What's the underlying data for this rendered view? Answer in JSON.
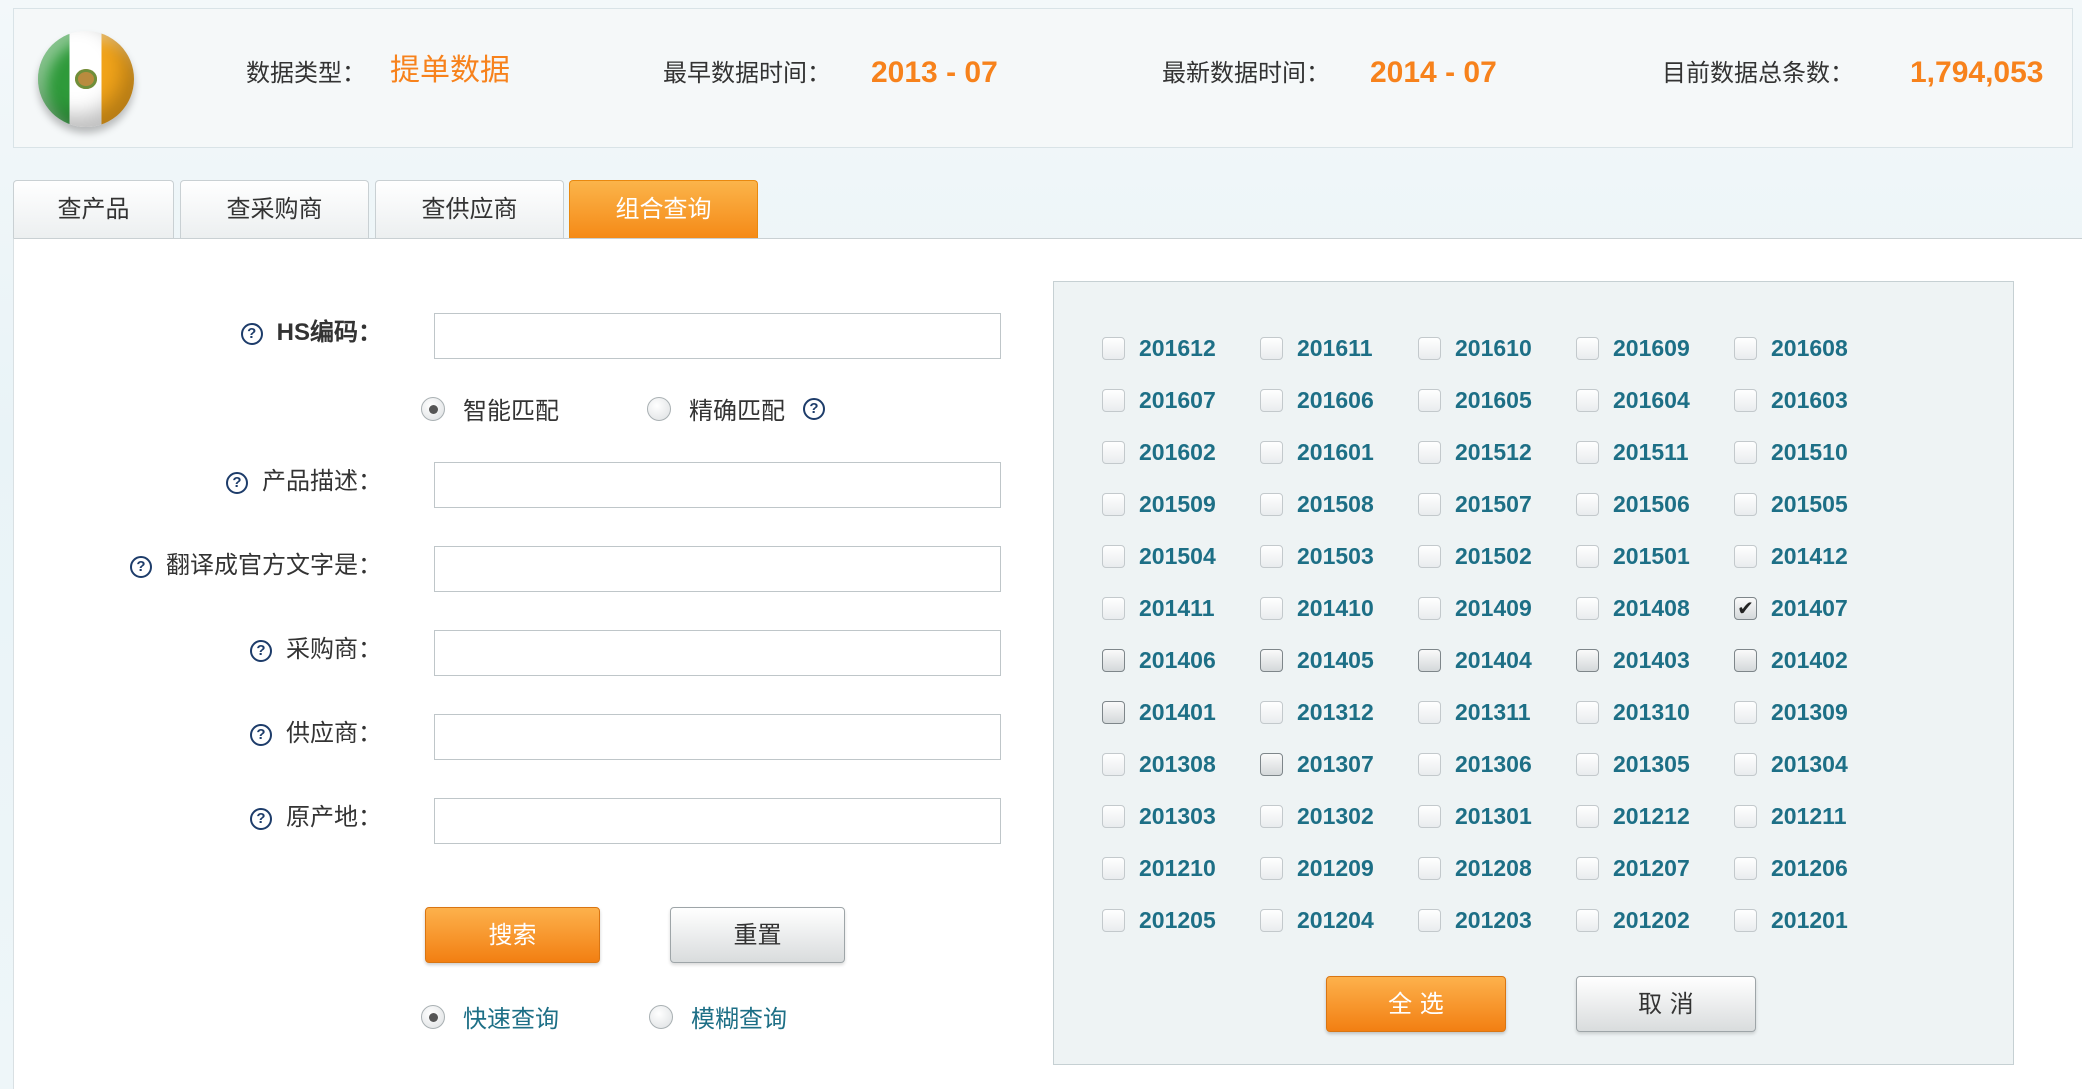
{
  "header": {
    "flag_icon": "mexico-flag-icon",
    "data_type_label": "数据类型：",
    "data_type_value": "提单数据",
    "earliest_label": "最早数据时间：",
    "earliest_value": "2013 - 07",
    "latest_label": "最新数据时间：",
    "latest_value": "2014 - 07",
    "total_label": "目前数据总条数：",
    "total_value": "1,794,053",
    "accent_color": "#f7821c"
  },
  "tabs": [
    {
      "label": "查产品",
      "active": false
    },
    {
      "label": "查采购商",
      "active": false
    },
    {
      "label": "查供应商",
      "active": false
    },
    {
      "label": "组合查询",
      "active": true
    }
  ],
  "form": {
    "help_icon": "?",
    "hs_label": "HS编码：",
    "hs_value": "",
    "match_options": [
      {
        "label": "智能匹配",
        "selected": true
      },
      {
        "label": "精确匹配",
        "selected": false
      }
    ],
    "product_label": "产品描述：",
    "product_value": "",
    "translate_label": "翻译成官方文字是：",
    "translate_value": "",
    "buyer_label": "采购商：",
    "buyer_value": "",
    "supplier_label": "供应商：",
    "supplier_value": "",
    "origin_label": "原产地：",
    "origin_value": "",
    "search_button": "搜索",
    "reset_button": "重置",
    "query_modes": [
      {
        "label": "快速查询",
        "selected": true
      },
      {
        "label": "模糊查询",
        "selected": false
      }
    ]
  },
  "months": {
    "items": [
      {
        "label": "201612",
        "checked": false,
        "style": "light"
      },
      {
        "label": "201611",
        "checked": false,
        "style": "light"
      },
      {
        "label": "201610",
        "checked": false,
        "style": "light"
      },
      {
        "label": "201609",
        "checked": false,
        "style": "light"
      },
      {
        "label": "201608",
        "checked": false,
        "style": "light"
      },
      {
        "label": "201607",
        "checked": false,
        "style": "light"
      },
      {
        "label": "201606",
        "checked": false,
        "style": "light"
      },
      {
        "label": "201605",
        "checked": false,
        "style": "light"
      },
      {
        "label": "201604",
        "checked": false,
        "style": "light"
      },
      {
        "label": "201603",
        "checked": false,
        "style": "light"
      },
      {
        "label": "201602",
        "checked": false,
        "style": "light"
      },
      {
        "label": "201601",
        "checked": false,
        "style": "light"
      },
      {
        "label": "201512",
        "checked": false,
        "style": "light"
      },
      {
        "label": "201511",
        "checked": false,
        "style": "light"
      },
      {
        "label": "201510",
        "checked": false,
        "style": "light"
      },
      {
        "label": "201509",
        "checked": false,
        "style": "light"
      },
      {
        "label": "201508",
        "checked": false,
        "style": "light"
      },
      {
        "label": "201507",
        "checked": false,
        "style": "light"
      },
      {
        "label": "201506",
        "checked": false,
        "style": "light"
      },
      {
        "label": "201505",
        "checked": false,
        "style": "light"
      },
      {
        "label": "201504",
        "checked": false,
        "style": "light"
      },
      {
        "label": "201503",
        "checked": false,
        "style": "light"
      },
      {
        "label": "201502",
        "checked": false,
        "style": "light"
      },
      {
        "label": "201501",
        "checked": false,
        "style": "light"
      },
      {
        "label": "201412",
        "checked": false,
        "style": "light"
      },
      {
        "label": "201411",
        "checked": false,
        "style": "light"
      },
      {
        "label": "201410",
        "checked": false,
        "style": "light"
      },
      {
        "label": "201409",
        "checked": false,
        "style": "light"
      },
      {
        "label": "201408",
        "checked": false,
        "style": "light"
      },
      {
        "label": "201407",
        "checked": true,
        "style": "dark"
      },
      {
        "label": "201406",
        "checked": false,
        "style": "dark"
      },
      {
        "label": "201405",
        "checked": false,
        "style": "dark"
      },
      {
        "label": "201404",
        "checked": false,
        "style": "dark"
      },
      {
        "label": "201403",
        "checked": false,
        "style": "dark"
      },
      {
        "label": "201402",
        "checked": false,
        "style": "dark"
      },
      {
        "label": "201401",
        "checked": false,
        "style": "dark"
      },
      {
        "label": "201312",
        "checked": false,
        "style": "light"
      },
      {
        "label": "201311",
        "checked": false,
        "style": "light"
      },
      {
        "label": "201310",
        "checked": false,
        "style": "light"
      },
      {
        "label": "201309",
        "checked": false,
        "style": "light"
      },
      {
        "label": "201308",
        "checked": false,
        "style": "light"
      },
      {
        "label": "201307",
        "checked": false,
        "style": "dark"
      },
      {
        "label": "201306",
        "checked": false,
        "style": "light"
      },
      {
        "label": "201305",
        "checked": false,
        "style": "light"
      },
      {
        "label": "201304",
        "checked": false,
        "style": "light"
      },
      {
        "label": "201303",
        "checked": false,
        "style": "light"
      },
      {
        "label": "201302",
        "checked": false,
        "style": "light"
      },
      {
        "label": "201301",
        "checked": false,
        "style": "light"
      },
      {
        "label": "201212",
        "checked": false,
        "style": "light"
      },
      {
        "label": "201211",
        "checked": false,
        "style": "light"
      },
      {
        "label": "201210",
        "checked": false,
        "style": "light"
      },
      {
        "label": "201209",
        "checked": false,
        "style": "light"
      },
      {
        "label": "201208",
        "checked": false,
        "style": "light"
      },
      {
        "label": "201207",
        "checked": false,
        "style": "light"
      },
      {
        "label": "201206",
        "checked": false,
        "style": "light"
      },
      {
        "label": "201205",
        "checked": false,
        "style": "light"
      },
      {
        "label": "201204",
        "checked": false,
        "style": "light"
      },
      {
        "label": "201203",
        "checked": false,
        "style": "light"
      },
      {
        "label": "201202",
        "checked": false,
        "style": "light"
      },
      {
        "label": "201201",
        "checked": false,
        "style": "light"
      }
    ],
    "select_all_button": "全 选",
    "cancel_button": "取 消",
    "label_color": "#1d6f86"
  }
}
